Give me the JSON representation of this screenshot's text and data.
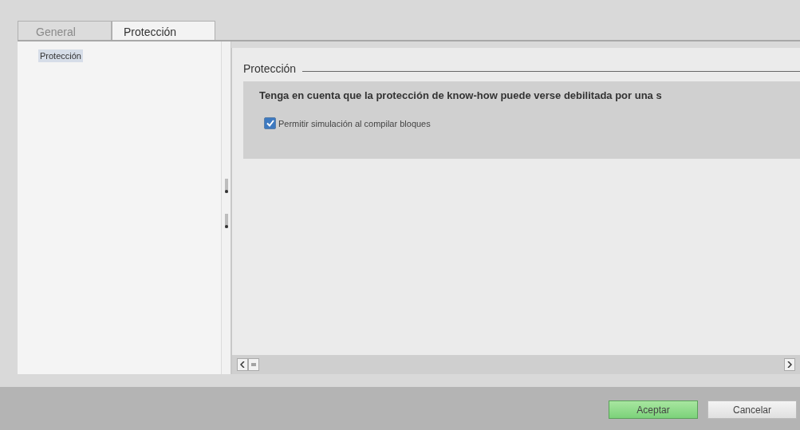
{
  "tabs": [
    {
      "label": "General",
      "selected": false
    },
    {
      "label": "Protección",
      "selected": true
    }
  ],
  "sidebar": {
    "items": [
      {
        "label": "Protección",
        "selected": true
      }
    ]
  },
  "section": {
    "title": "Protección",
    "notice": "Tenga en cuenta que la protección de know-how puede verse debilitada por una s",
    "checkbox": {
      "label": "Permitir simulación al compilar bloques",
      "checked": true
    }
  },
  "buttons": [
    {
      "label": "Aceptar",
      "kind": "primary"
    },
    {
      "label": "Cancelar",
      "kind": "secondary"
    }
  ]
}
